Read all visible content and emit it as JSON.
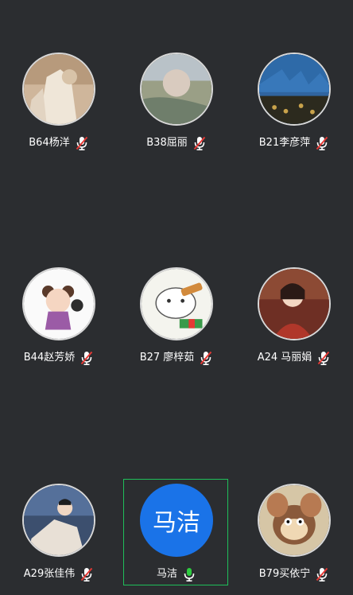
{
  "colors": {
    "background": "#2b2d30",
    "active_border": "#1fbf5a",
    "muted_mic": "#e53935",
    "active_mic": "#2ecc40",
    "text_avatar_bg": "#1a73e8"
  },
  "participants": [
    {
      "name": "B64杨洋",
      "mic": "muted-mic-icon",
      "avatar": "photo"
    },
    {
      "name": "B38屈丽",
      "mic": "muted-mic-icon",
      "avatar": "photo"
    },
    {
      "name": "B21李彦萍",
      "mic": "muted-mic-icon",
      "avatar": "photo"
    },
    {
      "name": "B44赵芳娇",
      "mic": "muted-mic-icon",
      "avatar": "cartoon"
    },
    {
      "name": "B27 廖梓茹",
      "mic": "muted-mic-icon",
      "avatar": "cartoon"
    },
    {
      "name": "A24 马丽娟",
      "mic": "muted-mic-icon",
      "avatar": "photo"
    },
    {
      "name": "A29张佳伟",
      "mic": "muted-mic-icon",
      "avatar": "cartoon"
    },
    {
      "name": "马洁",
      "mic": "active-mic-icon",
      "avatar_text": "马洁"
    },
    {
      "name": "B79买依宁",
      "mic": "muted-mic-icon",
      "avatar": "cartoon"
    }
  ]
}
